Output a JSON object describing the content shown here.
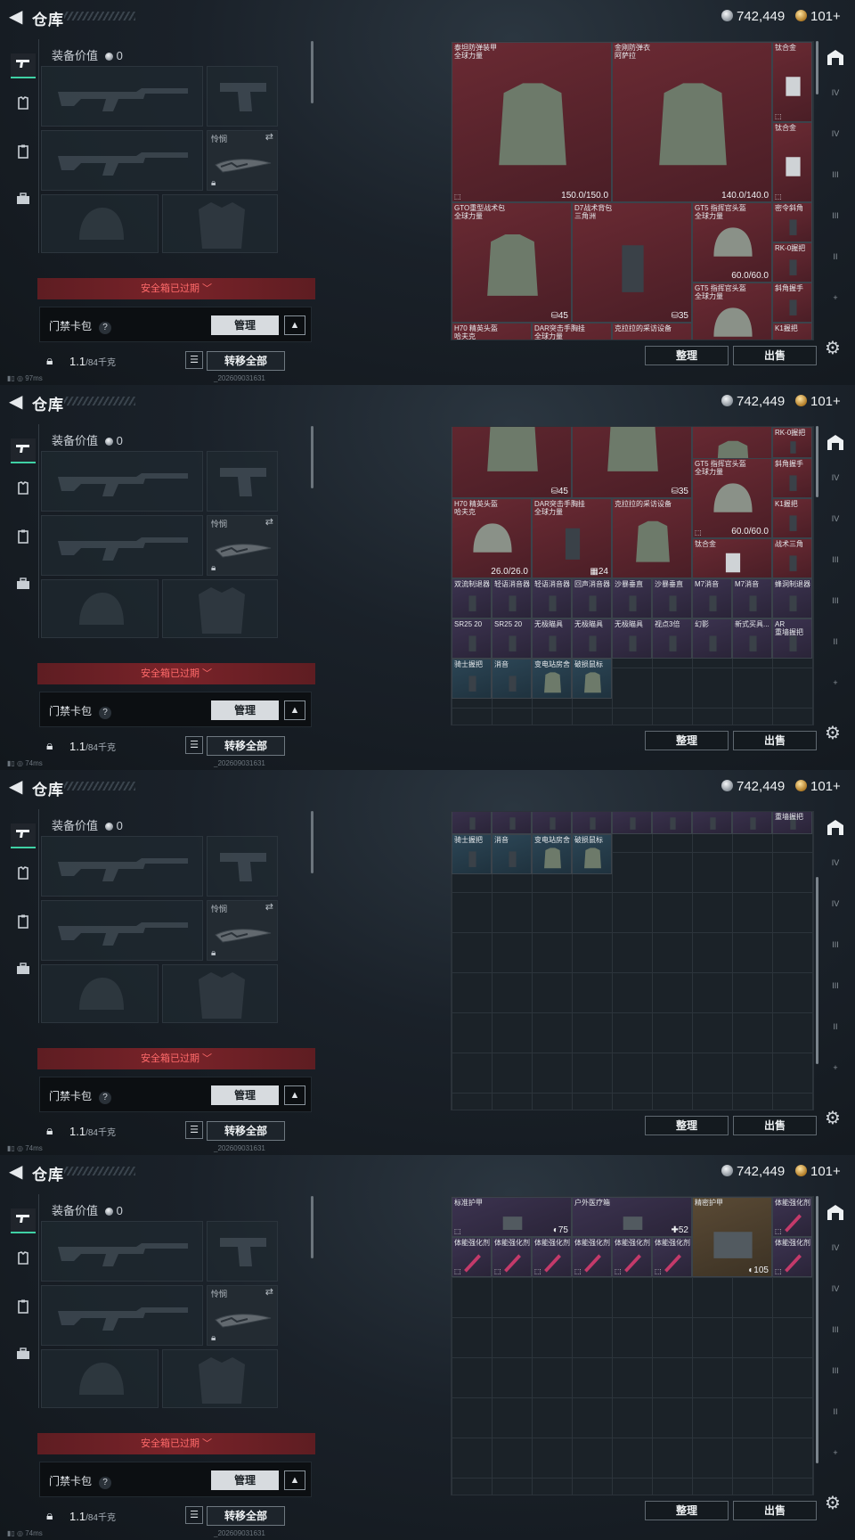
{
  "header": {
    "title": "仓库",
    "silver": "742,449",
    "gold": "101+"
  },
  "equipment": {
    "value_label": "装备价值",
    "value": "0",
    "knife_label": "怜悯",
    "safebox_expired": "安全箱已过期",
    "card_pack_label": "门禁卡包",
    "help": "?",
    "manage": "管理",
    "weight": "1.1",
    "weight_capacity": "/84千克",
    "transfer_all": "转移全部"
  },
  "inventory_buttons": {
    "sort": "整理",
    "sell": "出售"
  },
  "status": {
    "pings": [
      "97ms",
      "74ms",
      "74ms",
      "74ms"
    ],
    "uid": "_202609031631"
  },
  "rail": {
    "slots": [
      "IV",
      "IV",
      "III",
      "III",
      "II",
      "+"
    ]
  },
  "shots": [
    {
      "items": [
        {
          "name": "泰坦防弹装甲\n全球力量",
          "dur": "150.0/150.0",
          "color": "red",
          "mark": "⬚"
        },
        {
          "name": "金刚防弹衣\n阿萨拉",
          "dur": "140.0/140.0",
          "color": "red"
        },
        {
          "name": "钛合金",
          "color": "red",
          "mark": "⬚"
        },
        {
          "name": "钛合金",
          "color": "red",
          "mark": "⬚"
        },
        {
          "name": "GTO重型战术包\n全球力量",
          "cnt": "⛁45",
          "color": "red"
        },
        {
          "name": "D7战术背包\n三角洲",
          "cnt": "⛁35",
          "color": "red"
        },
        {
          "name": "GT5 指挥官头盔\n全球力量",
          "dur": "60.0/60.0",
          "color": "red"
        },
        {
          "name": "密令斜角",
          "color": "red"
        },
        {
          "name": "RK-0握把",
          "color": "red"
        },
        {
          "name": "GT5 指挥官头盔\n全球力量",
          "color": "red"
        },
        {
          "name": "斜角握手",
          "color": "red"
        },
        {
          "name": "H70 精英头盔\n哈夫克",
          "color": "red"
        },
        {
          "name": "DAR突击手胸挂\n全球力量",
          "color": "red"
        },
        {
          "name": "克拉拉的采访设备",
          "color": "red"
        },
        {
          "name": "K1握把",
          "color": "red"
        }
      ]
    },
    {
      "items": [
        {
          "name": "",
          "cnt": "⛁45",
          "color": "red"
        },
        {
          "name": "",
          "cnt": "⛁35",
          "color": "red"
        },
        {
          "name": "",
          "dur": "60.0/60.0",
          "color": "red"
        },
        {
          "name": "RK-0握把",
          "color": "red"
        },
        {
          "name": "GT5 指挥官头盔\n全球力量",
          "dur": "60.0/60.0",
          "color": "red",
          "mark": "⬚"
        },
        {
          "name": "斜角握手",
          "color": "red"
        },
        {
          "name": "H70 精英头盔\n哈夫克",
          "dur": "26.0/26.0",
          "color": "red"
        },
        {
          "name": "DAR突击手胸挂\n全球力量",
          "cnt": "▦24",
          "color": "red"
        },
        {
          "name": "克拉拉的采访设备",
          "color": "red"
        },
        {
          "name": "K1握把",
          "color": "red"
        },
        {
          "name": "钛合金",
          "color": "red"
        },
        {
          "name": "战术三角",
          "color": "red"
        },
        {
          "name": "双流制退器",
          "color": "purple"
        },
        {
          "name": "轻语消音器",
          "color": "purple"
        },
        {
          "name": "轻语消音器",
          "color": "purple"
        },
        {
          "name": "回声消音器",
          "color": "purple"
        },
        {
          "name": "沙暴垂直",
          "color": "purple"
        },
        {
          "name": "沙暴垂直",
          "color": "purple"
        },
        {
          "name": "M7消音",
          "color": "purple"
        },
        {
          "name": "M7消音",
          "color": "purple"
        },
        {
          "name": "蜂洞制退器",
          "color": "purple"
        },
        {
          "name": "SR25 20",
          "color": "purple"
        },
        {
          "name": "SR25 20",
          "color": "purple"
        },
        {
          "name": "无极瞄具",
          "color": "purple"
        },
        {
          "name": "无极瞄具",
          "color": "purple"
        },
        {
          "name": "无极瞄具",
          "color": "purple"
        },
        {
          "name": "视点3倍",
          "color": "purple"
        },
        {
          "name": "幻影",
          "color": "purple"
        },
        {
          "name": "新式买具...",
          "color": "purple"
        },
        {
          "name": "AR\n重墙握把",
          "color": "purple"
        },
        {
          "name": "骑士握把",
          "color": "blue"
        },
        {
          "name": "消音",
          "color": "blue"
        },
        {
          "name": "变电站房舍",
          "color": "blue"
        },
        {
          "name": "破损鼠标",
          "color": "blue"
        }
      ]
    },
    {
      "items": [
        {
          "name": "SR25 20",
          "color": "purple"
        },
        {
          "name": "SR25 20",
          "color": "purple"
        },
        {
          "name": "无极瞄具",
          "color": "purple"
        },
        {
          "name": "无极瞄具",
          "color": "purple"
        },
        {
          "name": "无极瞄具",
          "color": "purple"
        },
        {
          "name": "视点3倍",
          "color": "purple"
        },
        {
          "name": "幻影",
          "color": "purple"
        },
        {
          "name": "新式买具...",
          "color": "purple"
        },
        {
          "name": "AR\n重墙握把",
          "color": "purple"
        },
        {
          "name": "骑士握把",
          "color": "blue"
        },
        {
          "name": "消音",
          "color": "blue"
        },
        {
          "name": "变电站房舍",
          "color": "blue"
        },
        {
          "name": "破损鼠标",
          "color": "blue"
        }
      ]
    },
    {
      "items": [
        {
          "name": "标准护甲",
          "cnt": "◐75",
          "color": "purple",
          "mark": "⬚"
        },
        {
          "name": "户外医疗箱",
          "cnt": "✚52",
          "color": "purple"
        },
        {
          "name": "精密护甲",
          "cnt": "◐105",
          "color": "gold"
        },
        {
          "name": "体能强化剂",
          "color": "purple",
          "mark": "⬚"
        },
        {
          "name": "体能强化剂",
          "color": "purple",
          "mark": "⬚"
        },
        {
          "name": "体能强化剂",
          "color": "purple",
          "mark": "⬚"
        },
        {
          "name": "体能强化剂",
          "color": "purple",
          "mark": "⬚"
        },
        {
          "name": "体能强化剂",
          "color": "purple",
          "mark": "⬚"
        },
        {
          "name": "体能强化剂",
          "color": "purple",
          "mark": "⬚"
        },
        {
          "name": "体能强化剂",
          "color": "purple",
          "mark": "⬚"
        },
        {
          "name": "体能强化剂",
          "color": "purple",
          "mark": "⬚"
        },
        {
          "name": "体能强化剂",
          "color": "purple",
          "mark": "⬚"
        }
      ]
    }
  ]
}
